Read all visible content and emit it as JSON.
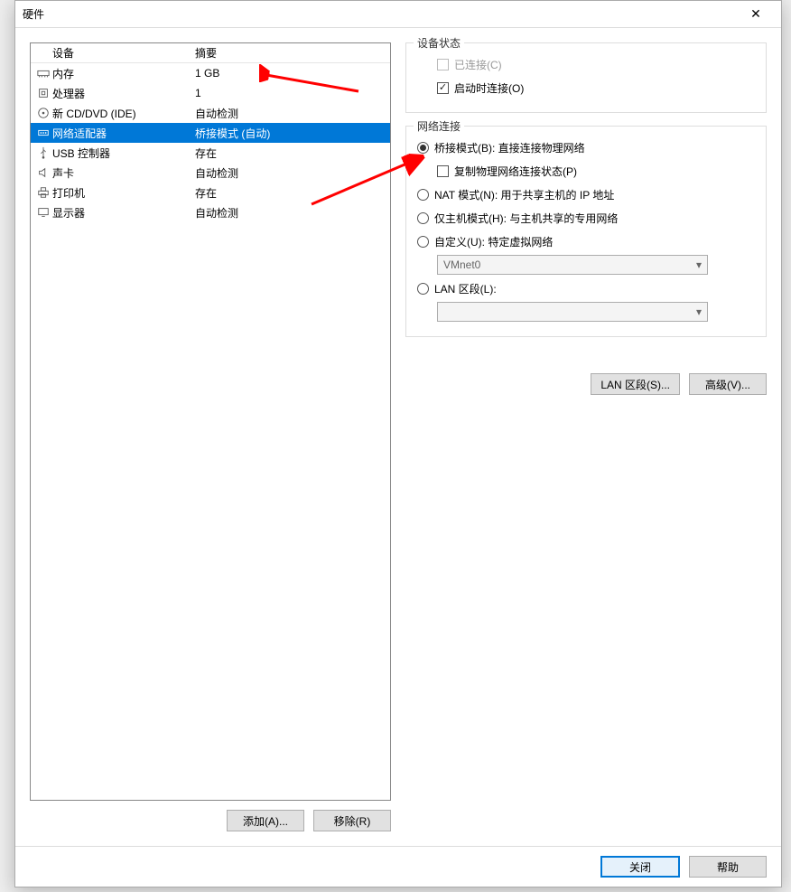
{
  "window": {
    "title": "硬件"
  },
  "hardware": {
    "header_device": "设备",
    "header_summary": "摘要",
    "rows": [
      {
        "icon": "memory-icon",
        "device": "内存",
        "summary": "1 GB",
        "selected": false
      },
      {
        "icon": "cpu-icon",
        "device": "处理器",
        "summary": "1",
        "selected": false
      },
      {
        "icon": "cd-icon",
        "device": "新 CD/DVD (IDE)",
        "summary": "自动检测",
        "selected": false
      },
      {
        "icon": "network-icon",
        "device": "网络适配器",
        "summary": "桥接模式 (自动)",
        "selected": true
      },
      {
        "icon": "usb-icon",
        "device": "USB 控制器",
        "summary": "存在",
        "selected": false
      },
      {
        "icon": "sound-icon",
        "device": "声卡",
        "summary": "自动检测",
        "selected": false
      },
      {
        "icon": "printer-icon",
        "device": "打印机",
        "summary": "存在",
        "selected": false
      },
      {
        "icon": "display-icon",
        "device": "显示器",
        "summary": "自动检测",
        "selected": false
      }
    ],
    "add_label": "添加(A)...",
    "remove_label": "移除(R)"
  },
  "device_status": {
    "legend": "设备状态",
    "connected_label": "已连接(C)",
    "connected_checked": false,
    "connected_disabled": true,
    "connect_on_start_label": "启动时连接(O)",
    "connect_on_start_checked": true
  },
  "network": {
    "legend": "网络连接",
    "bridged_label": "桥接模式(B): 直接连接物理网络",
    "replicate_label": "复制物理网络连接状态(P)",
    "nat_label": "NAT 模式(N): 用于共享主机的 IP 地址",
    "hostonly_label": "仅主机模式(H): 与主机共享的专用网络",
    "custom_label": "自定义(U): 特定虚拟网络",
    "custom_select": "VMnet0",
    "lan_label": "LAN 区段(L):",
    "lan_select": "",
    "selected": "bridged",
    "lan_segments_btn": "LAN 区段(S)...",
    "advanced_btn": "高级(V)..."
  },
  "footer": {
    "close_label": "关闭",
    "help_label": "帮助"
  }
}
